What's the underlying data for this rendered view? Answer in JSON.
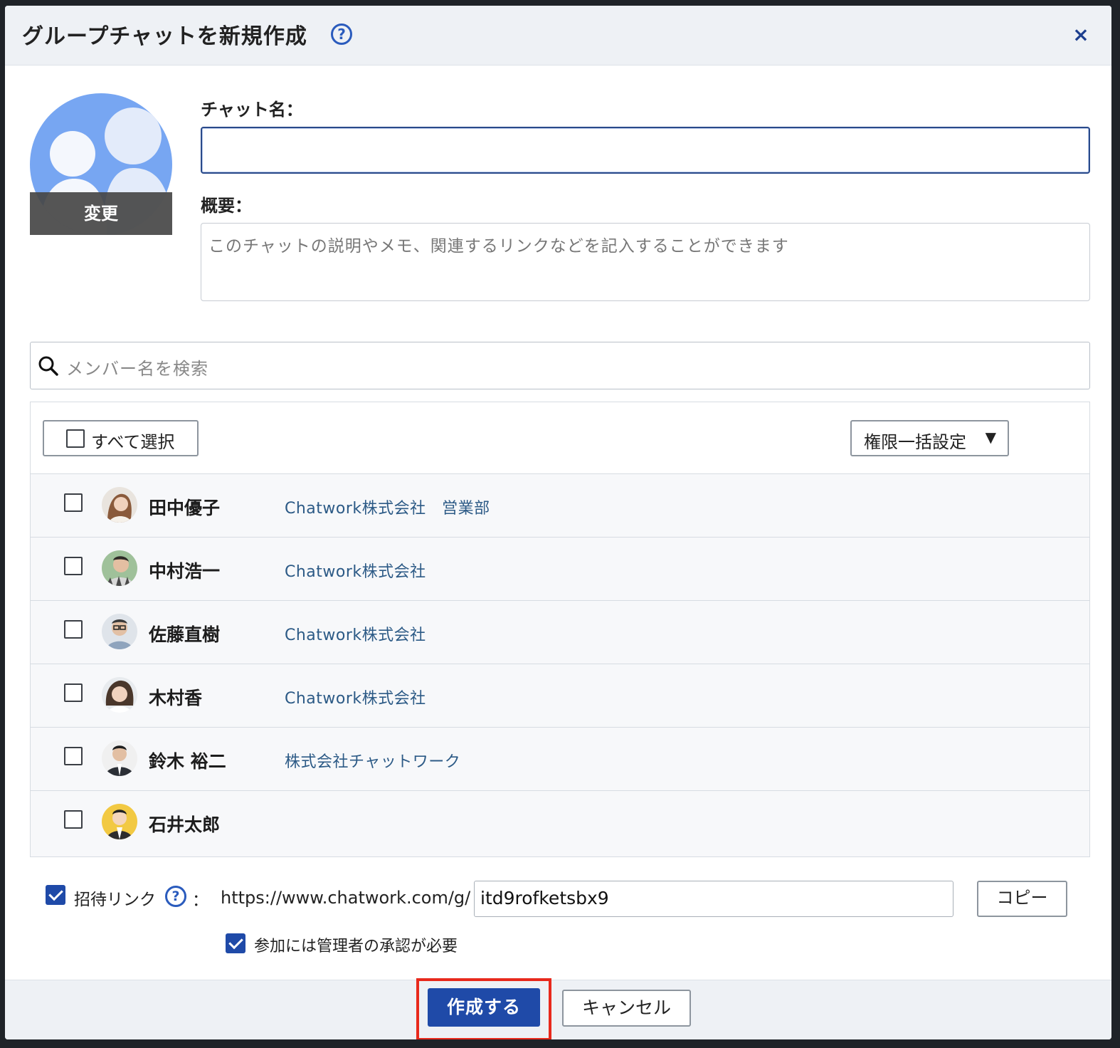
{
  "dialog": {
    "title": "グループチャットを新規作成",
    "help_glyph": "?",
    "close_glyph": "×"
  },
  "avatar": {
    "change_label": "変更"
  },
  "form": {
    "chat_name_label": "チャット名：",
    "chat_name_value": "",
    "description_label": "概要：",
    "description_placeholder": "このチャットの説明やメモ、関連するリンクなどを記入することができます"
  },
  "member_search": {
    "placeholder": "メンバー名を検索"
  },
  "member_list": {
    "select_all_label": "すべて選択",
    "bulk_permission_label": "権限一括設定",
    "bulk_permission_caret": "▼",
    "members": [
      {
        "name": "田中優子",
        "org": "Chatwork株式会社　営業部",
        "checked": false,
        "avatar_color": "#c9a184"
      },
      {
        "name": "中村浩一",
        "org": "Chatwork株式会社",
        "checked": false,
        "avatar_color": "#7fa383"
      },
      {
        "name": "佐藤直樹",
        "org": "Chatwork株式会社",
        "checked": false,
        "avatar_color": "#a9b4c2"
      },
      {
        "name": "木村香",
        "org": "Chatwork株式会社",
        "checked": false,
        "avatar_color": "#5c4a3c"
      },
      {
        "name": "鈴木 裕二",
        "org": "株式会社チャットワーク",
        "checked": false,
        "avatar_color": "#3a3f46"
      },
      {
        "name": "石井太郎",
        "org": "",
        "checked": false,
        "avatar_color": "#f2c943"
      }
    ]
  },
  "invite": {
    "enabled": true,
    "label": "招待リンク",
    "colon": "：",
    "base_url": "https://www.chatwork.com/g/",
    "code": "itd9rofketsbx9",
    "copy_label": "コピー",
    "approval_required": true,
    "approval_label": "参加には管理者の承認が必要"
  },
  "footer": {
    "create_label": "作成する",
    "cancel_label": "キャンセル"
  },
  "colors": {
    "primary": "#1f4aa8",
    "highlight": "#e8291c",
    "org_text": "#2c5a86"
  }
}
